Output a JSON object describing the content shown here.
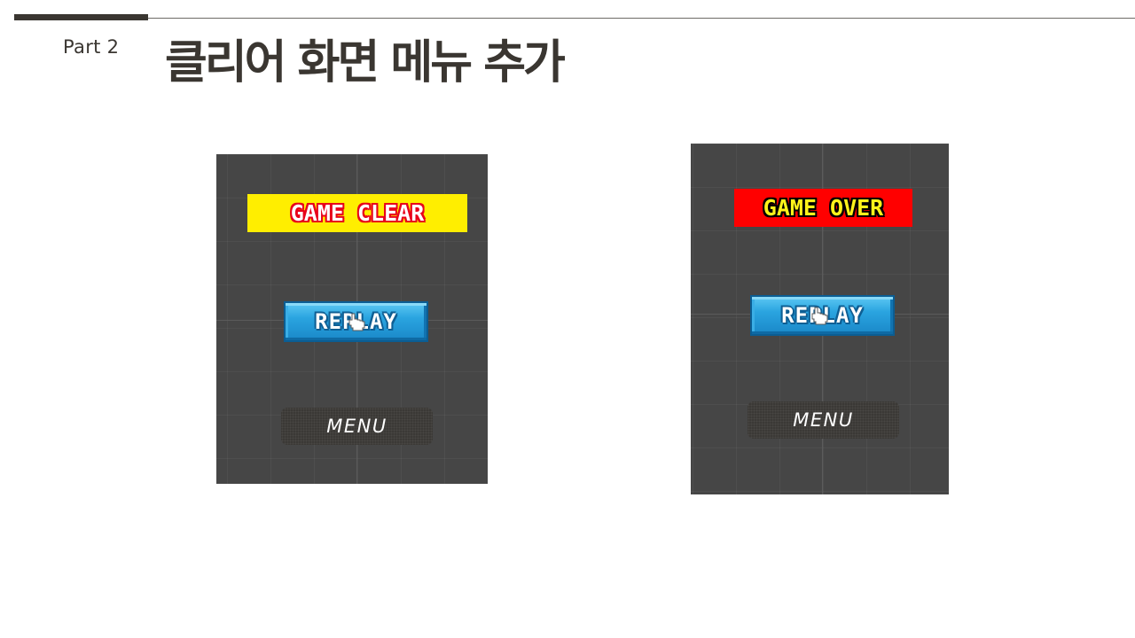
{
  "slide": {
    "part_label": "Part 2",
    "title": "클리어 화면 메뉴 추가"
  },
  "screens": {
    "clear": {
      "banner_text": "GAME CLEAR",
      "replay_label": "REPLAY",
      "menu_label": "MENU"
    },
    "over": {
      "banner_text": "GAME OVER",
      "replay_label": "REPLAY",
      "menu_label": "MENU"
    }
  },
  "colors": {
    "title_text": "#3a3631",
    "screen_bg": "#464646",
    "clear_banner_bg": "#ffee00",
    "clear_banner_text_outline": "#e8001a",
    "over_banner_bg": "#ff0000",
    "over_banner_text": "#fff21a",
    "replay_button": "#2aa4e0",
    "menu_button": "#3b3936"
  },
  "icons": {
    "cursor": "hand-pointer-icon"
  }
}
